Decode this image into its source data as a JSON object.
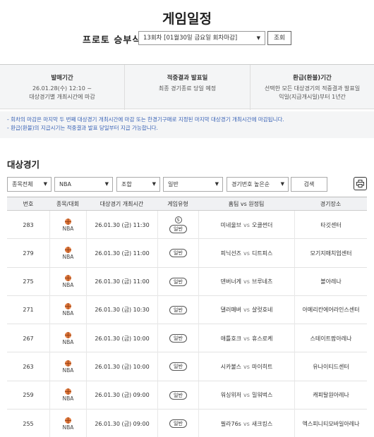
{
  "page": {
    "title": "게임일정"
  },
  "selector": {
    "label": "프로토 승부식",
    "round_value": "13회차 [01월30일 금요일 회차마감]",
    "search_label": "조회"
  },
  "info": [
    {
      "head": "발매기간",
      "lines": [
        "26.01.28(수) 12:10 ~",
        "대상경기별 개최시간에 마감"
      ]
    },
    {
      "head": "적중결과 발표일",
      "lines": [
        "최종 경기종료 당일 예정"
      ]
    },
    {
      "head": "환급(환불)기간",
      "lines": [
        "선택한 모든 대상경기의 적중결과 발표일",
        "익일(지급개시일)부터 1년간"
      ]
    }
  ],
  "notes": [
    "- 회차의 마감은 마지막 두 번째 대상경기 개최시간에 마감 또는 한경기구매로 지정된 마지막 대상경기 개최시간에 마감됩니다.",
    "- 환급(환불)의 지급시기는 적중결과 발표 당일부터 지급 가능합니다."
  ],
  "section": {
    "title": "대상경기"
  },
  "filters": {
    "sport": "종목전체",
    "league": "NBA",
    "combo": "조합",
    "type": "일반",
    "sort": "경기번호 높은순",
    "search_label": "검색"
  },
  "icons": {
    "ball": "basketball-icon",
    "print": "printer-icon",
    "dropdown": "chevron-down-icon",
    "single": "s-badge-icon"
  },
  "colors": {
    "ball": "#e07a3e",
    "note_text": "#3a63b6"
  },
  "table": {
    "headers": [
      "번호",
      "종목/대회",
      "대상경기 개최시간",
      "게임유형",
      "홈팀  vs  원정팀",
      "경기장소"
    ],
    "rows": [
      {
        "no": "283",
        "league": "NBA",
        "time": "26.01.30 (금) 11:30",
        "single": "S",
        "type": "일반",
        "home": "미네울브",
        "vs": "vs",
        "away": "오클썬더",
        "venue": "타깃센터"
      },
      {
        "no": "279",
        "league": "NBA",
        "time": "26.01.30 (금) 11:00",
        "single": "",
        "type": "일반",
        "home": "피닉선즈",
        "vs": "vs",
        "away": "디트피스",
        "venue": "모기지매치업센터"
      },
      {
        "no": "275",
        "league": "NBA",
        "time": "26.01.30 (금) 11:00",
        "single": "",
        "type": "일반",
        "home": "덴버너게",
        "vs": "vs",
        "away": "브루네츠",
        "venue": "볼아레나"
      },
      {
        "no": "271",
        "league": "NBA",
        "time": "26.01.30 (금) 10:30",
        "single": "",
        "type": "일반",
        "home": "댈러매버",
        "vs": "vs",
        "away": "샬럿호네",
        "venue": "아메리칸에어라인스센터"
      },
      {
        "no": "267",
        "league": "NBA",
        "time": "26.01.30 (금) 10:00",
        "single": "",
        "type": "일반",
        "home": "애틀호크",
        "vs": "vs",
        "away": "휴스로케",
        "venue": "스테이트팜아레나"
      },
      {
        "no": "263",
        "league": "NBA",
        "time": "26.01.30 (금) 10:00",
        "single": "",
        "type": "일반",
        "home": "시카불스",
        "vs": "vs",
        "away": "마이히트",
        "venue": "유나이티드센터"
      },
      {
        "no": "259",
        "league": "NBA",
        "time": "26.01.30 (금) 09:00",
        "single": "",
        "type": "일반",
        "home": "워싱위저",
        "vs": "vs",
        "away": "밀워벅스",
        "venue": "캐피탈원아레나"
      },
      {
        "no": "255",
        "league": "NBA",
        "time": "26.01.30 (금) 09:00",
        "single": "",
        "type": "일반",
        "home": "필라76s",
        "vs": "vs",
        "away": "새크킹스",
        "venue": "엑스피니티모바일아레나"
      }
    ]
  }
}
